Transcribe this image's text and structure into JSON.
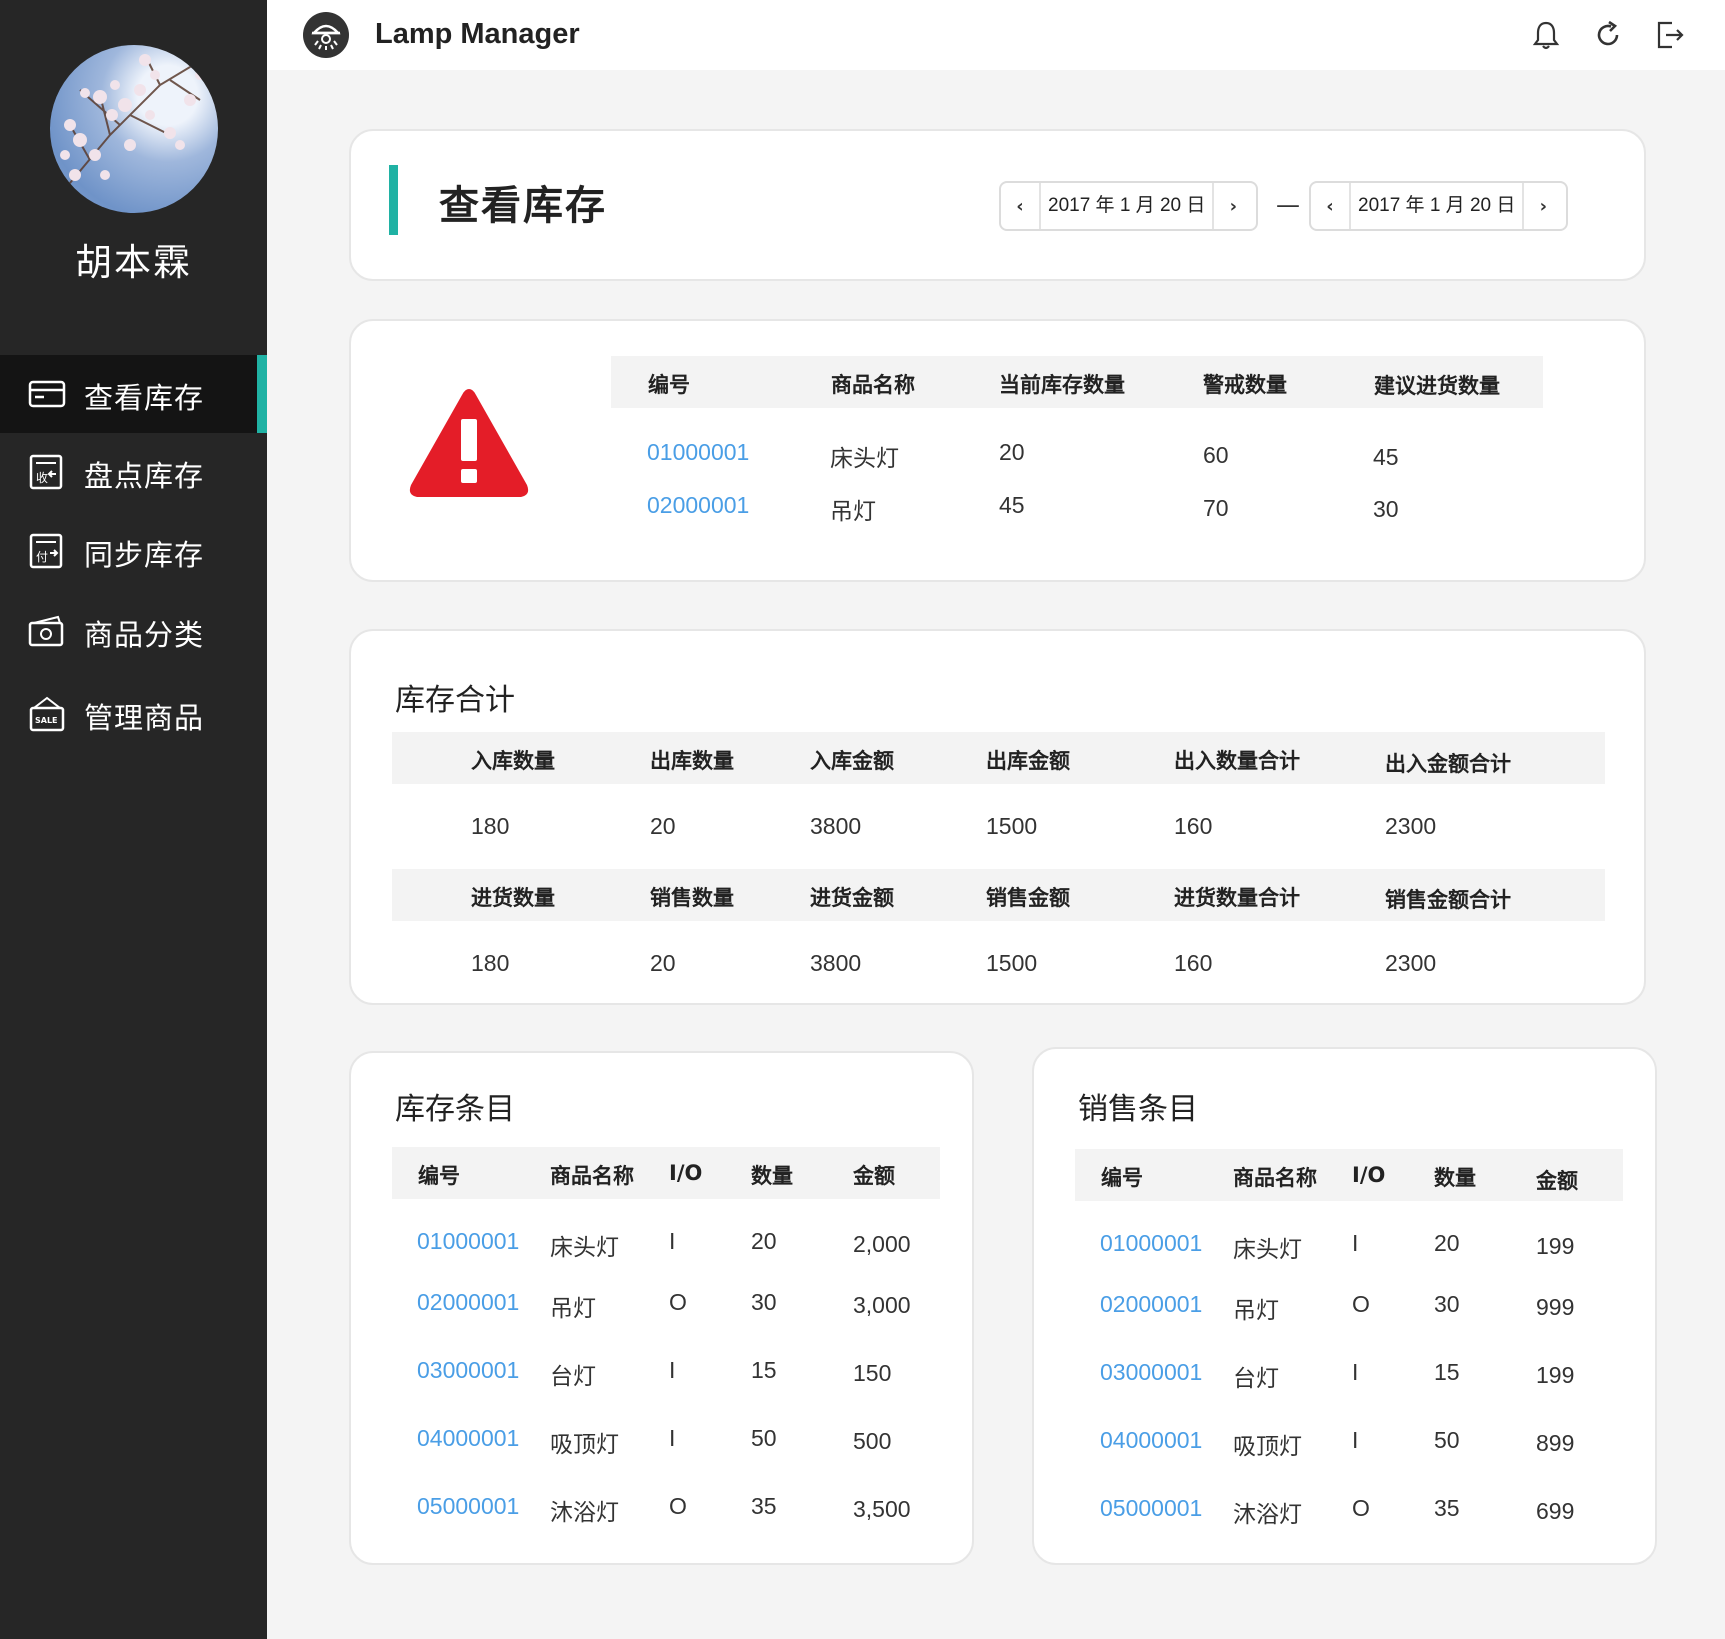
{
  "app": {
    "title": "Lamp Manager"
  },
  "user": {
    "name": "胡本霖"
  },
  "sidebar": {
    "items": [
      {
        "label": "查看库存",
        "icon": "card-icon",
        "active": true
      },
      {
        "label": "盘点库存",
        "icon": "receipt-in-icon",
        "active": false
      },
      {
        "label": "同步库存",
        "icon": "receipt-pay-icon",
        "active": false
      },
      {
        "label": "商品分类",
        "icon": "cash-icon",
        "active": false
      },
      {
        "label": "管理商品",
        "icon": "sale-sign-icon",
        "active": false
      }
    ]
  },
  "header_icons": [
    "bell-icon",
    "refresh-icon",
    "logout-icon"
  ],
  "page": {
    "title": "查看库存",
    "date_from": "2017 年 1 月 20 日",
    "date_to": "2017 年 1 月 20 日",
    "date_separator": "—"
  },
  "alert": {
    "icon": "warning-icon",
    "headers": [
      "编号",
      "商品名称",
      "当前库存数量",
      "警戒数量",
      "建议进货数量"
    ],
    "rows": [
      [
        "01000001",
        "床头灯",
        "20",
        "60",
        "45"
      ],
      [
        "02000001",
        "吊灯",
        "45",
        "70",
        "30"
      ]
    ]
  },
  "summary": {
    "title": "库存合计",
    "headers1": [
      "入库数量",
      "出库数量",
      "入库金额",
      "出库金额",
      "出入数量合计",
      "出入金额合计"
    ],
    "values1": [
      "180",
      "20",
      "3800",
      "1500",
      "160",
      "2300"
    ],
    "headers2": [
      "进货数量",
      "销售数量",
      "进货金额",
      "销售金额",
      "进货数量合计",
      "销售金额合计"
    ],
    "values2": [
      "180",
      "20",
      "3800",
      "1500",
      "160",
      "2300"
    ]
  },
  "stock_entries": {
    "title": "库存条目",
    "headers": [
      "编号",
      "商品名称",
      "I/O",
      "数量",
      "金额"
    ],
    "rows": [
      [
        "01000001",
        "床头灯",
        "I",
        "20",
        "2,000"
      ],
      [
        "02000001",
        "吊灯",
        "O",
        "30",
        "3,000"
      ],
      [
        "03000001",
        "台灯",
        "I",
        "15",
        "150"
      ],
      [
        "04000001",
        "吸顶灯",
        "I",
        "50",
        "500"
      ],
      [
        "05000001",
        "沐浴灯",
        "O",
        "35",
        "3,500"
      ]
    ]
  },
  "sales_entries": {
    "title": "销售条目",
    "headers": [
      "编号",
      "商品名称",
      "I/O",
      "数量",
      "金额"
    ],
    "rows": [
      [
        "01000001",
        "床头灯",
        "I",
        "20",
        "199"
      ],
      [
        "02000001",
        "吊灯",
        "O",
        "30",
        "999"
      ],
      [
        "03000001",
        "台灯",
        "I",
        "15",
        "199"
      ],
      [
        "04000001",
        "吸顶灯",
        "I",
        "50",
        "899"
      ],
      [
        "05000001",
        "沐浴灯",
        "O",
        "35",
        "699"
      ]
    ]
  },
  "colors": {
    "accent": "#20b2a4",
    "sidebar": "#262626",
    "link": "#4a9ee6",
    "warning": "#e41d28"
  }
}
